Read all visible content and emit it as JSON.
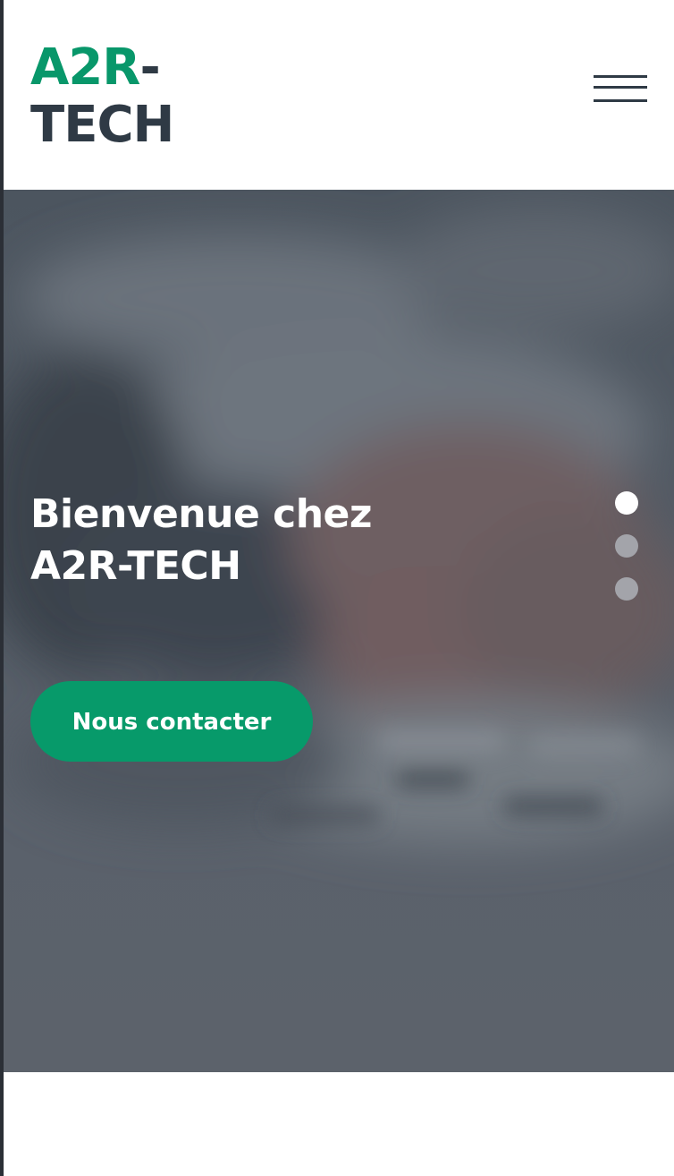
{
  "header": {
    "logo_accent": "A2R",
    "logo_dash": "-",
    "logo_rest": "TECH",
    "menu_icon": "hamburger-menu-icon"
  },
  "hero": {
    "title_line1": "Bienvenue chez",
    "title_line2": "A2R-TECH",
    "cta_label": "Nous contacter",
    "background": "blurred photo of a hand typing on a keyboard",
    "slides": {
      "count": 3,
      "active": 1
    }
  },
  "colors": {
    "accent": "#08976a",
    "dark": "#2f3a45",
    "overlay": "#5c636c"
  }
}
